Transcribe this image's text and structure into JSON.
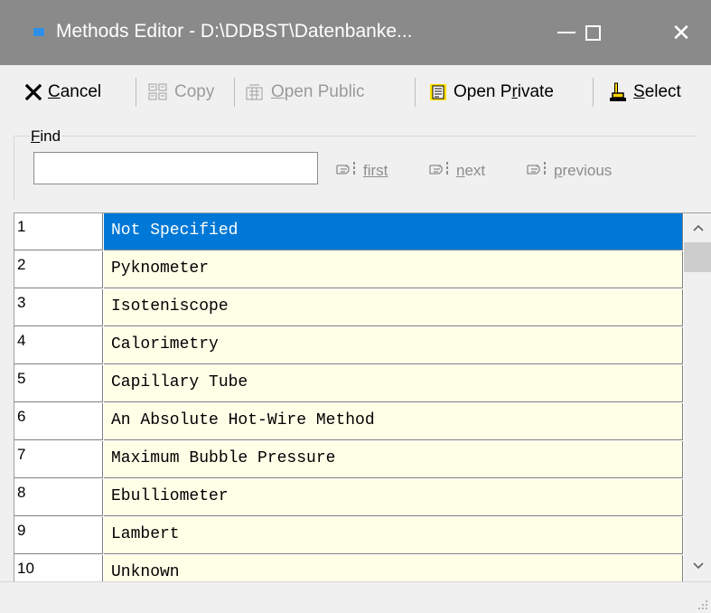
{
  "window": {
    "title": "Methods Editor - D:\\DDBST\\Datenbanke...",
    "close_glyph": "✕"
  },
  "toolbar": {
    "cancel": {
      "icon": "x-icon",
      "prefix": "",
      "accel": "C",
      "rest": "ancel"
    },
    "copy": {
      "icon": "copy-records-icon",
      "text": "Copy"
    },
    "open_public": {
      "icon": "open-public-icon",
      "prefix": "",
      "accel": "O",
      "rest": "pen Public"
    },
    "open_private": {
      "icon": "open-private-icon",
      "prefix": "Open P",
      "accel": "r",
      "rest": "ivate"
    },
    "select": {
      "icon": "hand-pointer-icon",
      "prefix": "",
      "accel": "S",
      "rest": "elect"
    }
  },
  "find": {
    "legend_accel": "F",
    "legend_rest": "ind",
    "value": "",
    "first": "first",
    "next": {
      "accel": "n",
      "rest": "ext"
    },
    "previous": {
      "accel": "p",
      "rest": "revious"
    }
  },
  "methods": [
    {
      "id": "1",
      "name": "Not Specified"
    },
    {
      "id": "2",
      "name": "Pyknometer"
    },
    {
      "id": "3",
      "name": "Isoteniscope"
    },
    {
      "id": "4",
      "name": "Calorimetry"
    },
    {
      "id": "5",
      "name": "Capillary Tube"
    },
    {
      "id": "6",
      "name": "An Absolute Hot-Wire Method"
    },
    {
      "id": "7",
      "name": "Maximum Bubble Pressure"
    },
    {
      "id": "8",
      "name": "Ebulliometer"
    },
    {
      "id": "9",
      "name": "Lambert"
    },
    {
      "id": "10",
      "name": "Unknown"
    }
  ],
  "selected_row": 0,
  "colors": {
    "selection": "#0078d7",
    "cell_background": "#ffffe8",
    "titlebar": "#8a8a8a"
  }
}
